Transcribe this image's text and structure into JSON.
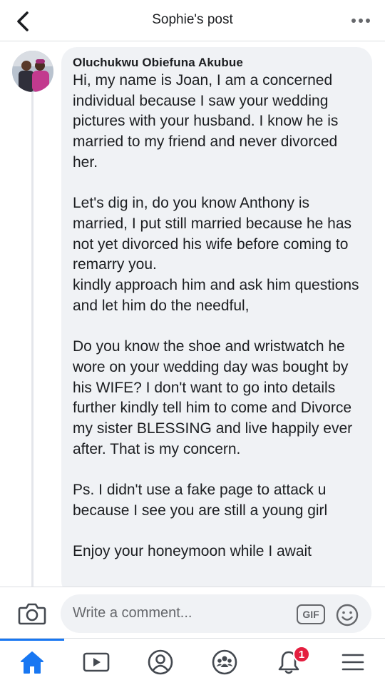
{
  "header": {
    "title": "Sophie's post",
    "back_icon": "chevron-left-icon",
    "more_icon": "more-horizontal-icon"
  },
  "comment": {
    "author": "Oluchukwu Obiefuna Akubue",
    "text": "Hi, my name is Joan, I am a concerned individual because I saw your wedding pictures with your husband. I know he is married to my friend and never divorced her.\n\nLet's dig in, do you know Anthony is married, I put still married because he has not yet divorced his wife before coming to remarry you.\nkindly approach him and ask him questions and let him do the needful,\n\nDo you know the shoe and wristwatch he wore on your wedding day was bought by his WIFE? I don't want to go into details further kindly tell him to come and Divorce my sister BLESSING and live happily ever after. That is my concern.\n\nPs. I didn't use a fake page to attack u because I see you are still a young girl\n\nEnjoy your honeymoon while I await"
  },
  "composer": {
    "placeholder": "Write a comment...",
    "gif_label": "GIF",
    "camera_icon": "camera-icon",
    "emoji_icon": "emoji-icon"
  },
  "nav": {
    "items": [
      {
        "icon": "home-icon",
        "active": true
      },
      {
        "icon": "watch-icon",
        "active": false
      },
      {
        "icon": "profile-icon",
        "active": false
      },
      {
        "icon": "groups-icon",
        "active": false
      },
      {
        "icon": "notifications-icon",
        "active": false,
        "badge": "1"
      },
      {
        "icon": "menu-icon",
        "active": false
      }
    ]
  },
  "colors": {
    "accent": "#1877f2",
    "badge": "#e41e3f",
    "bubble": "#f0f2f5",
    "secondary_text": "#65676b"
  }
}
